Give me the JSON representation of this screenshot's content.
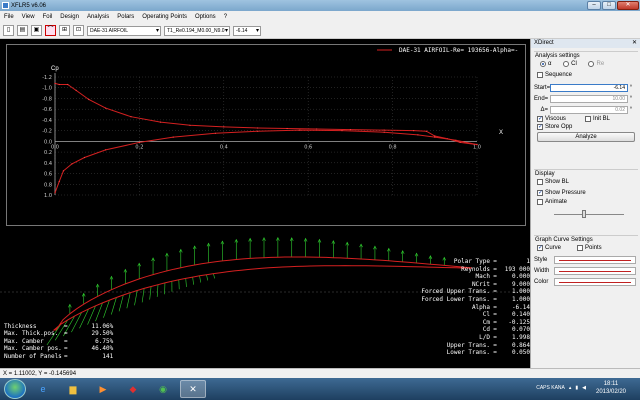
{
  "window": {
    "title": "XFLR5 v6.06",
    "min": "–",
    "max": "□",
    "close": "✕"
  },
  "menu": [
    "File",
    "View",
    "Foil",
    "Design",
    "Analysis",
    "Polars",
    "Operating Points",
    "Options",
    "?"
  ],
  "toolbar": {
    "foil_select": "DAE-31 AIRFOIL",
    "polar_select": "T1_Re0.194_M0.00_N9.0",
    "alpha_select": "-6.14"
  },
  "cp_plot": {
    "ylabel": "Cp",
    "xlabel": "X",
    "legend": "DAE-31 AIRFOIL-Re=  193656-Alpha=-",
    "y_ticks": [
      "-1.2",
      "-1.0",
      "-0.8",
      "-0.6",
      "-0.4",
      "-0.2",
      "0.0",
      "0.2",
      "0.4",
      "0.6",
      "0.8",
      "1.0"
    ],
    "x_ticks": [
      "0.0",
      "0.2",
      "0.4",
      "0.6",
      "0.8",
      "1.0"
    ],
    "upper_color": "#d42020",
    "lower_color": "#d42020"
  },
  "chart_data": {
    "type": "line",
    "ylabel": "Cp",
    "xlabel": "X",
    "ylim": [
      -1.2,
      1.0
    ],
    "y_inverted": true,
    "xlim": [
      0.0,
      1.0
    ],
    "legend": "DAE-31 AIRFOIL-Re=  193656-Alpha=-",
    "series": [
      {
        "x": [
          0.0,
          0.01,
          0.03,
          0.05,
          0.08,
          0.12,
          0.18,
          0.25,
          0.32,
          0.4,
          0.48,
          0.55,
          0.62,
          0.7,
          0.78,
          0.85,
          0.88,
          0.9,
          0.93,
          0.96,
          1.0
        ],
        "y": [
          -1.08,
          -1.06,
          -1.06,
          -0.95,
          -0.78,
          -0.62,
          -0.46,
          -0.36,
          -0.3,
          -0.27,
          -0.25,
          -0.24,
          -0.23,
          -0.22,
          -0.21,
          -0.2,
          -0.19,
          -0.1,
          -0.05,
          0.02,
          0.06
        ]
      },
      {
        "x": [
          0.0,
          0.01,
          0.02,
          0.04,
          0.07,
          0.12,
          0.2,
          0.28,
          0.38,
          0.48,
          0.58,
          0.68,
          0.78,
          0.86,
          0.9,
          0.95,
          1.0
        ],
        "y": [
          0.96,
          0.75,
          0.55,
          0.42,
          0.3,
          0.16,
          0.02,
          -0.08,
          -0.15,
          -0.19,
          -0.21,
          -0.2,
          -0.17,
          -0.12,
          -0.08,
          -0.02,
          0.06
        ]
      }
    ]
  },
  "foil_props": [
    {
      "label": "Thickness",
      "value": "11.06%"
    },
    {
      "label": "Max. Thick.pos.",
      "value": "29.50%"
    },
    {
      "label": "Max. Camber",
      "value": "6.75%"
    },
    {
      "label": "Max. Camber pos.",
      "value": "46.40%"
    },
    {
      "label": "Number of Panels",
      "value": "141"
    }
  ],
  "results": [
    {
      "label": "Polar Type",
      "value": "1",
      "unit": ""
    },
    {
      "label": "Reynolds",
      "value": "193 000",
      "unit": ""
    },
    {
      "label": "Mach",
      "value": "0.000",
      "unit": ""
    },
    {
      "label": "NCrit",
      "value": "9.000",
      "unit": ""
    },
    {
      "label": "Forced Upper Trans.",
      "value": "1.000",
      "unit": ""
    },
    {
      "label": "Forced Lower Trans.",
      "value": "1.000",
      "unit": ""
    },
    {
      "label": "Alpha",
      "value": "-6.14",
      "unit": "°"
    },
    {
      "label": "Cl",
      "value": "0.140",
      "unit": ""
    },
    {
      "label": "Cm",
      "value": "-0.125",
      "unit": ""
    },
    {
      "label": "Cd",
      "value": "0.070",
      "unit": ""
    },
    {
      "label": "L/D",
      "value": "1.998",
      "unit": ""
    },
    {
      "label": "Upper Trans.",
      "value": "0.864",
      "unit": ""
    },
    {
      "label": "Lower Trans.",
      "value": "0.050",
      "unit": ""
    }
  ],
  "coords": "X = 1.11002, Y = -0.145694",
  "xdirect": {
    "title": "XDirect",
    "close": "✕",
    "analysis_settings": "Analysis settings",
    "radio_alpha": "α",
    "radio_cl": "Cl",
    "radio_re": "Re",
    "sequence": "Sequence",
    "start_label": "Start=",
    "start_value": "-6.14",
    "end_label": "End=",
    "end_value": "10.00",
    "delta_label": "Δ=",
    "delta_value": "0.02",
    "deg": "°",
    "viscous": "Viscous",
    "init_bl": "Init BL",
    "store_opp": "Store Opp",
    "analyze": "Analyze",
    "display": "Display",
    "show_bl": "Show BL",
    "show_pressure": "Show Pressure",
    "animate": "Animate",
    "graph_settings": "Graph Curve Settings",
    "curve": "Curve",
    "points": "Points",
    "style": "Style",
    "width": "Width",
    "color": "Color"
  },
  "taskbar": {
    "ime": "CAPS KANA",
    "time": "18:11",
    "date": "2013/02/20"
  }
}
